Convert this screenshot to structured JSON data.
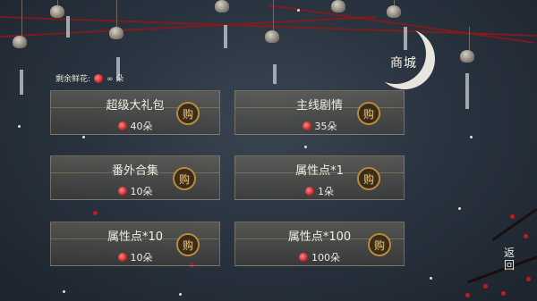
{
  "header": {
    "shop_title": "商城"
  },
  "currency": {
    "label": "剩余鲜花:",
    "icon": "rose-icon",
    "value": "∞ 朵"
  },
  "items": [
    {
      "name": "超级大礼包",
      "price": "40朵",
      "buy_label": "购"
    },
    {
      "name": "主线剧情",
      "price": "35朵",
      "buy_label": "购"
    },
    {
      "name": "番外合集",
      "price": "10朵",
      "buy_label": "购"
    },
    {
      "name": "属性点*1",
      "price": "1朵",
      "buy_label": "购"
    },
    {
      "name": "属性点*10",
      "price": "10朵",
      "buy_label": "购"
    },
    {
      "name": "属性点*100",
      "price": "100朵",
      "buy_label": "购"
    }
  ],
  "footer": {
    "back_label": "返回"
  },
  "colors": {
    "accent": "#b98a3a",
    "rose": "#c01818",
    "rope": "#8a1a1a"
  }
}
